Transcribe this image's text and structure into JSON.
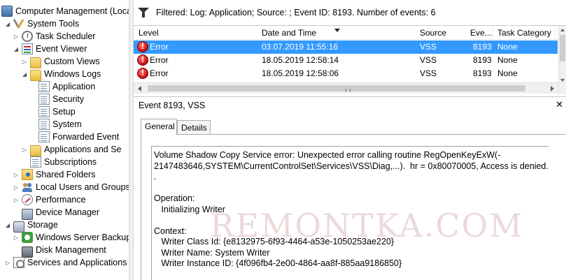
{
  "tree": {
    "items": [
      {
        "label": "Computer Management (Local",
        "icon": "computer-icon",
        "expander": "",
        "selected": false
      },
      {
        "label": "System Tools",
        "icon": "tools-icon",
        "expander": "◢",
        "selected": false
      },
      {
        "label": "Task Scheduler",
        "icon": "clock-icon",
        "expander": "▷",
        "selected": false
      },
      {
        "label": "Event Viewer",
        "icon": "event-viewer-icon",
        "expander": "◢",
        "selected": false
      },
      {
        "label": "Custom Views",
        "icon": "folder-icon",
        "expander": "▷",
        "selected": false
      },
      {
        "label": "Windows Logs",
        "icon": "folder-icon",
        "expander": "◢",
        "selected": false
      },
      {
        "label": "Application",
        "icon": "log-icon",
        "expander": "",
        "selected": true
      },
      {
        "label": "Security",
        "icon": "log-icon",
        "expander": "",
        "selected": false
      },
      {
        "label": "Setup",
        "icon": "log-icon",
        "expander": "",
        "selected": false
      },
      {
        "label": "System",
        "icon": "log-icon",
        "expander": "",
        "selected": false
      },
      {
        "label": "Forwarded Event",
        "icon": "log-icon",
        "expander": "",
        "selected": false
      },
      {
        "label": "Applications and Se",
        "icon": "folder-icon",
        "expander": "▷",
        "selected": false
      },
      {
        "label": "Subscriptions",
        "icon": "subscriptions-icon",
        "expander": "",
        "selected": false
      },
      {
        "label": "Shared Folders",
        "icon": "shared-folder-icon",
        "expander": "▷",
        "selected": false
      },
      {
        "label": "Local Users and Groups",
        "icon": "users-icon",
        "expander": "▷",
        "selected": false
      },
      {
        "label": "Performance",
        "icon": "performance-icon",
        "expander": "▷",
        "selected": false
      },
      {
        "label": "Device Manager",
        "icon": "device-manager-icon",
        "expander": "",
        "selected": false
      },
      {
        "label": "Storage",
        "icon": "storage-icon",
        "expander": "◢",
        "selected": false
      },
      {
        "label": "Windows Server Backup",
        "icon": "backup-icon",
        "expander": "▷",
        "selected": false
      },
      {
        "label": "Disk Management",
        "icon": "disk-icon",
        "expander": "",
        "selected": false
      },
      {
        "label": "Services and Applications",
        "icon": "services-icon",
        "expander": "▷",
        "selected": false
      }
    ]
  },
  "filter": {
    "text": "Filtered: Log: Application; Source: ; Event ID: 8193. Number of events: 6"
  },
  "event_list": {
    "columns": [
      "Level",
      "Date and Time",
      "Source",
      "Eve...",
      "Task Category"
    ],
    "rows": [
      {
        "level": "Error",
        "datetime": "03.07.2019 11:55:16",
        "source": "VSS",
        "event_id": "8193",
        "category": "None",
        "selected": true
      },
      {
        "level": "Error",
        "datetime": "18.05.2019 12:58:14",
        "source": "VSS",
        "event_id": "8193",
        "category": "None",
        "selected": false
      },
      {
        "level": "Error",
        "datetime": "18.05.2019 12:58:06",
        "source": "VSS",
        "event_id": "8193",
        "category": "None",
        "selected": false
      }
    ]
  },
  "detail": {
    "title": "Event 8193, VSS",
    "close": "✕",
    "tabs": [
      "General",
      "Details"
    ],
    "message_lines": [
      "Volume Shadow Copy Service error: Unexpected error calling routine RegOpenKeyExW(-",
      "2147483646,SYSTEM\\CurrentControlSet\\Services\\VSS\\Diag,...).  hr = 0x80070005, Access is denied.",
      ".",
      "",
      "Operation:",
      "   Initializing Writer",
      "",
      "Context:",
      "   Writer Class Id: {e8132975-6f93-4464-a53e-1050253ae220}",
      "   Writer Name: System Writer",
      "   Writer Instance ID: {4f096fb4-2e00-4864-aa8f-885aa9186850}"
    ]
  },
  "watermark": "REMONTKA.COM",
  "colors": {
    "selection": "#3399ff",
    "error": "#c40d0d"
  }
}
